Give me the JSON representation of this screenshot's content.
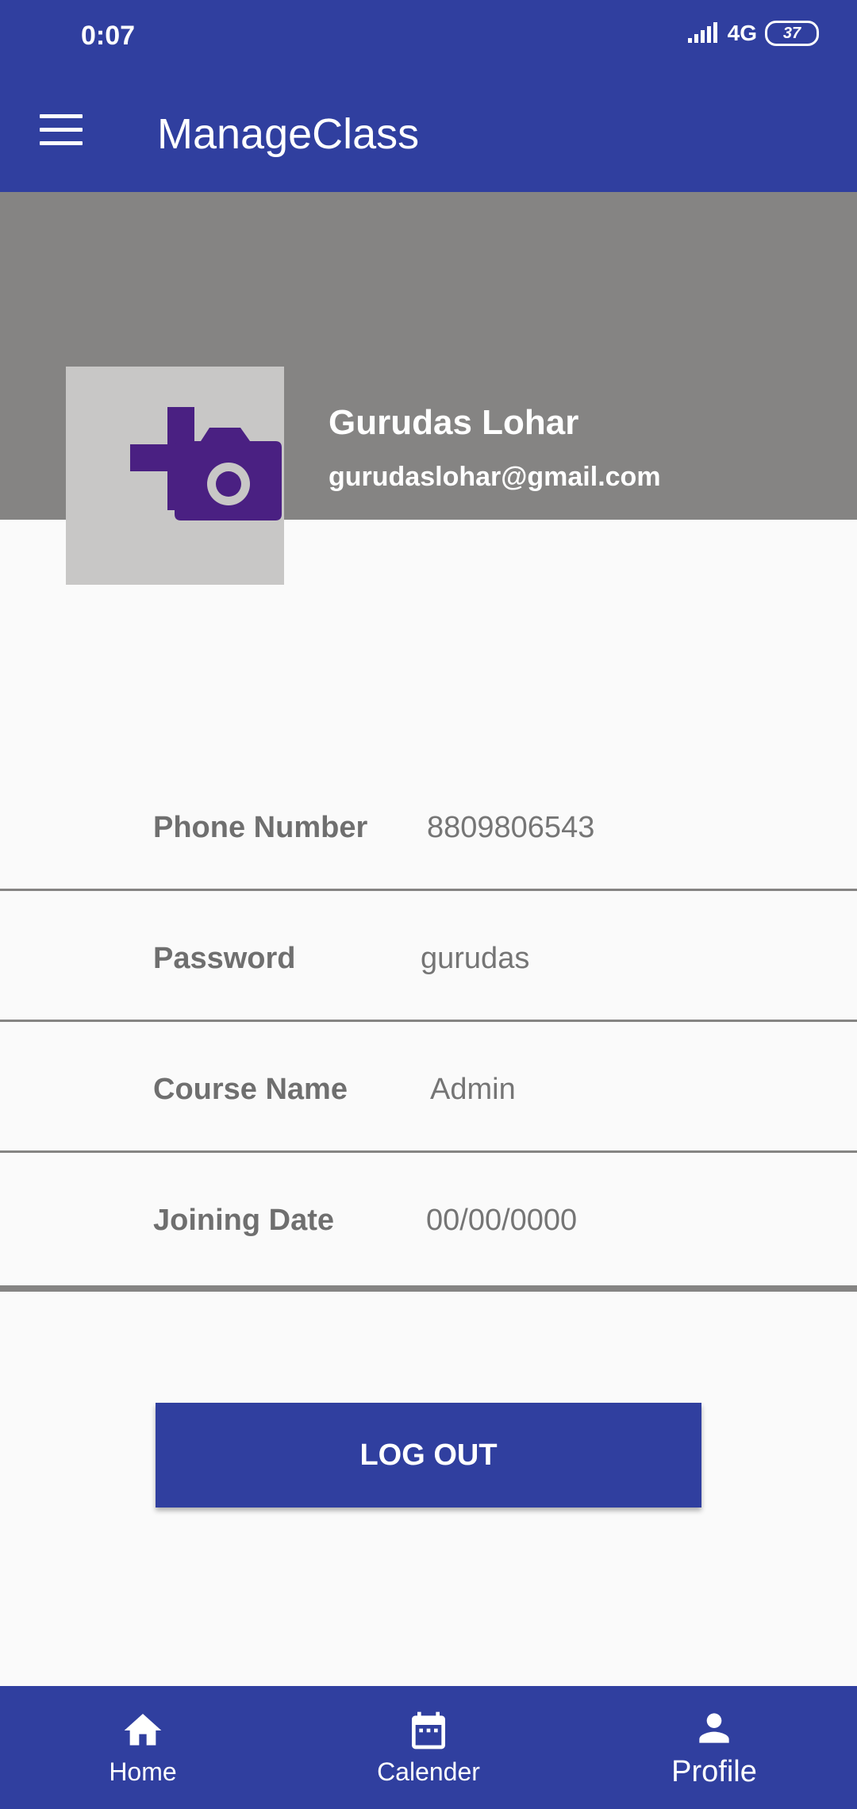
{
  "status": {
    "time": "0:07",
    "network": "4G",
    "battery": "37"
  },
  "appbar": {
    "title": "ManageClass"
  },
  "profile": {
    "name": "Gurudas Lohar",
    "email": "gurudaslohar@gmail.com"
  },
  "fields": [
    {
      "label": "Phone Number",
      "value": "8809806543"
    },
    {
      "label": "Password",
      "value": "gurudas"
    },
    {
      "label": "Course Name",
      "value": "Admin"
    },
    {
      "label": "Joining Date",
      "value": "00/00/0000"
    }
  ],
  "logout_label": "LOG OUT",
  "nav": [
    {
      "label": "Home",
      "icon": "home-icon"
    },
    {
      "label": "Calender",
      "icon": "calendar-icon"
    },
    {
      "label": "Profile",
      "icon": "person-icon"
    }
  ],
  "colors": {
    "primary": "#303f9f",
    "header_band": "#858483",
    "avatar_bg": "#c8c7c6",
    "camera": "#4a2082"
  }
}
